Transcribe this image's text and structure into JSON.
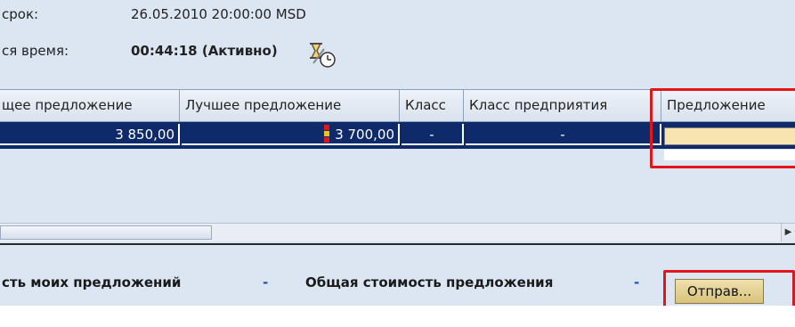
{
  "info": {
    "deadline_label": "срок:",
    "deadline_value": "26.05.2010 20:00:00 MSD",
    "remaining_label": "ся время:",
    "remaining_value": "00:44:18 (Активно)",
    "remaining_icon": "clock-hourglass-icon"
  },
  "grid": {
    "columns": [
      "щее предложение",
      "Лучшее предложение",
      "Класс",
      "Класс предприятия",
      "Предложение"
    ],
    "row": {
      "total_offer": "3 850,00",
      "best_offer": "3 700,00",
      "best_offer_icon": "rank-flag-icon",
      "class": "-",
      "company_class": "-",
      "offer_input_value": ""
    }
  },
  "footer": {
    "my_offers_label": "сть моих предложений",
    "my_offers_value": "-",
    "total_offer_label": "Общая стоимость предложения",
    "total_offer_value": "-",
    "submit_label": "Отправ..."
  },
  "colors": {
    "selected_row": "#0f2a6a",
    "input_bg": "#f8e4b0",
    "highlight": "#e3141a",
    "panel_bg": "#dce6f3",
    "dash": "#1f4fb5"
  }
}
